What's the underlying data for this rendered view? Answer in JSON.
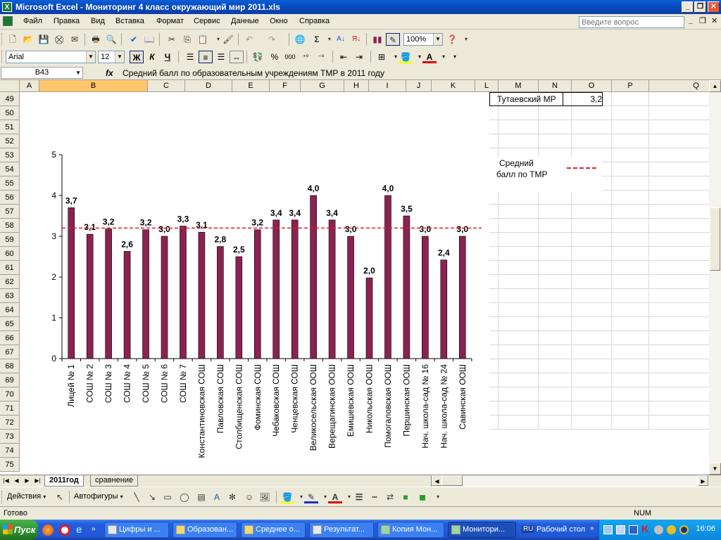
{
  "window": {
    "title": "Microsoft Excel - Мониторинг 4 класс окружающий мир 2011.xls",
    "app_icon": "X"
  },
  "menu": {
    "items": [
      "Файл",
      "Правка",
      "Вид",
      "Вставка",
      "Формат",
      "Сервис",
      "Данные",
      "Окно",
      "Справка"
    ],
    "help_placeholder": "Введите вопрос"
  },
  "toolbar": {
    "zoom": "100%"
  },
  "format_toolbar": {
    "font": "Arial",
    "size": "12",
    "bold": "Ж",
    "italic": "К",
    "underline": "Ч",
    "percent": "%",
    "thousands": "000"
  },
  "formula_bar": {
    "cell_ref": "B43",
    "fx": "fx",
    "formula": "Средний балл по образовательным учреждениям ТМР в 2011 году"
  },
  "columns": [
    "A",
    "B",
    "C",
    "D",
    "E",
    "F",
    "G",
    "H",
    "I",
    "J",
    "K",
    "L",
    "M",
    "N",
    "O",
    "P",
    "Q"
  ],
  "rows": [
    "49",
    "50",
    "51",
    "52",
    "53",
    "54",
    "55",
    "56",
    "57",
    "58",
    "59",
    "60",
    "61",
    "62",
    "63",
    "64",
    "65",
    "66",
    "67",
    "68",
    "69",
    "70",
    "71",
    "72",
    "73",
    "74",
    "75"
  ],
  "cells": {
    "m49": "Тутаевский МР",
    "o49": "3,2"
  },
  "legend": {
    "label": "Средний балл по ТМР",
    "line1": "Средний",
    "line2": "балл по ТМР"
  },
  "chart_data": {
    "type": "bar",
    "categories": [
      "Лицей № 1",
      "СОШ № 2",
      "СОШ № 3",
      "СОШ № 4",
      "СОШ № 5",
      "СОШ № 6",
      "СОШ № 7",
      "Константиновская СОШ",
      "Павловская СОШ",
      "Столбищенская СОШ",
      "Фоминская СОШ",
      "Чебаковская СОШ",
      "Ченцевская СОШ",
      "Великосельская ООШ",
      "Верещагинская ООШ",
      "Емишевская ООШ",
      "Никольская ООШ",
      "Помогаловская ООШ",
      "Першинская ООШ",
      "Нач. школа-сад № 16",
      "Нач. школа-сад № 24",
      "Савинская ООШ"
    ],
    "values": [
      3.7,
      3.05,
      3.18,
      2.63,
      3.16,
      3.0,
      3.25,
      3.1,
      2.75,
      2.5,
      3.16,
      3.4,
      3.4,
      4.0,
      3.4,
      3.0,
      1.98,
      4.0,
      3.5,
      3.0,
      2.42,
      3.0
    ],
    "value_labels": [
      "3,7",
      "3,1",
      "3,2",
      "2,6",
      "3,2",
      "3,0",
      "3,3",
      "3,1",
      "2,8",
      "2,5",
      "3,2",
      "3,4",
      "3,4",
      "4,0",
      "3,4",
      "3,0",
      "2,0",
      "4,0",
      "3,5",
      "3,0",
      "2,4",
      "3,0"
    ],
    "reference_line": {
      "name": "Средний балл по ТМР",
      "value": 3.2
    },
    "ylim": [
      0,
      5
    ],
    "yticks": [
      "0",
      "1",
      "2",
      "3",
      "4",
      "5"
    ],
    "grid": false,
    "legend_position": "right",
    "bar_color": "#8B2252",
    "reference_color": "#E0202E"
  },
  "sheets": {
    "tabs": [
      "2011год",
      "сравнение"
    ],
    "active": "2011год"
  },
  "draw_toolbar": {
    "actions": "Действия",
    "autoshapes": "Автофигуры"
  },
  "status": {
    "ready": "Готово",
    "num": "NUM"
  },
  "taskbar": {
    "start": "Пуск",
    "tasks": [
      "Цифры и ...",
      "Образован...",
      "Среднее о...",
      "Результат...",
      "Копия Мон...",
      "Монитори..."
    ],
    "lang": "RU",
    "desktop": "Рабочий стол",
    "clock": "16:06"
  }
}
